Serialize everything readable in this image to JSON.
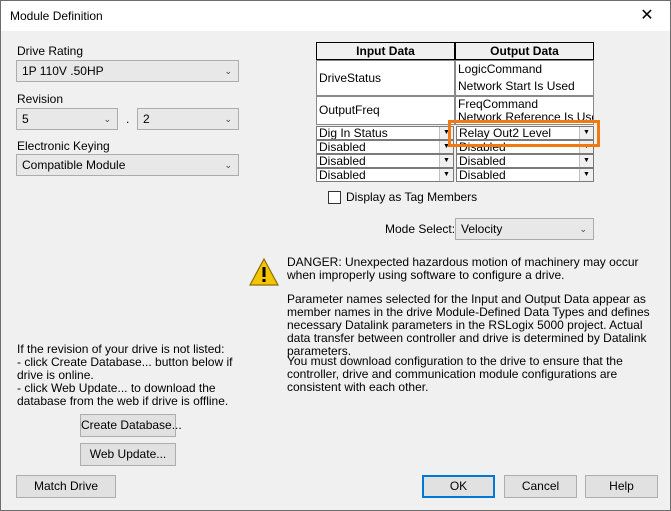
{
  "window": {
    "title": "Module Definition",
    "close_glyph": "✕"
  },
  "drive_rating": {
    "label": "Drive Rating",
    "value": "1P 110V  .50HP"
  },
  "revision": {
    "label": "Revision",
    "major": "5",
    "separator": ".",
    "minor": "2"
  },
  "electronic_keying": {
    "label": "Electronic Keying",
    "value": "Compatible Module"
  },
  "table": {
    "input_header": "Input Data",
    "output_header": "Output Data",
    "input_fixed": [
      "DriveStatus",
      "OutputFreq"
    ],
    "output_fixed": [
      [
        "LogicCommand",
        "Network Start Is Used"
      ],
      [
        "FreqCommand",
        "Network Reference Is Used"
      ]
    ],
    "input_selects": [
      "Dig In Status",
      "Disabled",
      "Disabled",
      "Disabled"
    ],
    "output_selects": [
      "Relay Out2 Level",
      "Disabled",
      "Disabled",
      "Disabled"
    ]
  },
  "display_tag_members": {
    "label": "Display as Tag Members",
    "checked": false
  },
  "mode_select": {
    "label": "Mode Select:",
    "value": "Velocity"
  },
  "messages": {
    "danger": "DANGER: Unexpected hazardous motion of machinery may occur when improperly using software to configure a drive.",
    "parameters": "Parameter names selected for the Input and Output Data appear as member names in the drive Module-Defined Data Types and defines necessary Datalink parameters in the RSLogix 5000 project.  Actual data transfer between controller and drive is determined by Datalink parameters.",
    "download": "You must download configuration to the drive to ensure that the controller, drive and communication module configurations are consistent with each other."
  },
  "revision_note": {
    "line1": "If the revision of your drive is not listed:",
    "line2": "- click Create Database... button below if drive is online.",
    "line3": "- click Web Update... to download the database from the web if drive is offline."
  },
  "buttons": {
    "create_database": "Create Database...",
    "web_update": "Web Update...",
    "match_drive": "Match Drive",
    "ok": "OK",
    "cancel": "Cancel",
    "help": "Help"
  },
  "colors": {
    "highlight": "#f07a10",
    "default_button_border": "#0078d7",
    "warning_yellow": "#f5c400"
  }
}
